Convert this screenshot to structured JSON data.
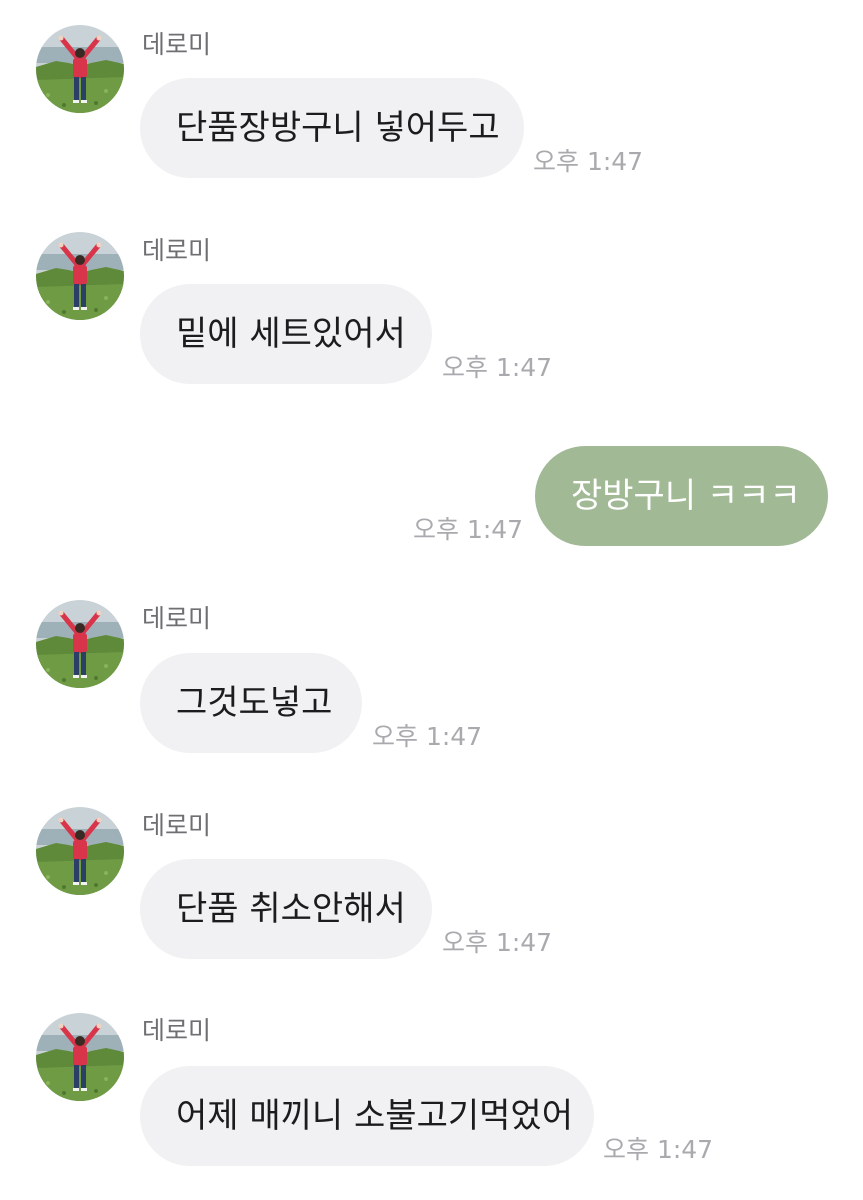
{
  "colors": {
    "incoming_bubble": "#f1f1f4",
    "outgoing_bubble": "#a1b995",
    "sender_name": "#6e6e73",
    "timestamp": "#a9a9ae",
    "background": "#ffffff"
  },
  "messages": [
    {
      "direction": "incoming",
      "sender": "데로미",
      "text": "단품장방구니 넣어두고",
      "time": "오후 1:47",
      "avatar": "profile-photo-icon"
    },
    {
      "direction": "incoming",
      "sender": "데로미",
      "text": "밑에 세트있어서",
      "time": "오후 1:47",
      "avatar": "profile-photo-icon"
    },
    {
      "direction": "outgoing",
      "text": "장방구니 ㅋㅋㅋ",
      "time": "오후 1:47"
    },
    {
      "direction": "incoming",
      "sender": "데로미",
      "text": "그것도넣고",
      "time": "오후 1:47",
      "avatar": "profile-photo-icon"
    },
    {
      "direction": "incoming",
      "sender": "데로미",
      "text": "단품 취소안해서",
      "time": "오후 1:47",
      "avatar": "profile-photo-icon"
    },
    {
      "direction": "incoming",
      "sender": "데로미",
      "text": "어제 매끼니 소불고기먹었어",
      "time": "오후 1:47",
      "avatar": "profile-photo-icon"
    }
  ]
}
